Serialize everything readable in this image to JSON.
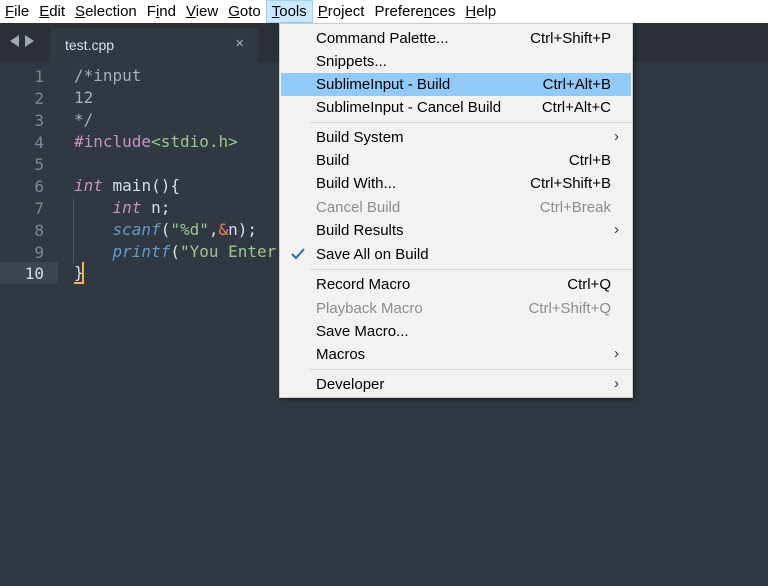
{
  "menubar": {
    "items": [
      {
        "pre": "",
        "u": "F",
        "post": "ile"
      },
      {
        "pre": "",
        "u": "E",
        "post": "dit"
      },
      {
        "pre": "",
        "u": "S",
        "post": "election"
      },
      {
        "pre": "F",
        "u": "i",
        "post": "nd"
      },
      {
        "pre": "",
        "u": "V",
        "post": "iew"
      },
      {
        "pre": "",
        "u": "G",
        "post": "oto"
      },
      {
        "pre": "",
        "u": "T",
        "post": "ools"
      },
      {
        "pre": "",
        "u": "P",
        "post": "roject"
      },
      {
        "pre": "Prefere",
        "u": "n",
        "post": "ces"
      },
      {
        "pre": "",
        "u": "H",
        "post": "elp"
      }
    ]
  },
  "tab": {
    "label": "test.cpp",
    "close": "×"
  },
  "editor": {
    "lines": [
      {
        "num": "1",
        "code": "/*input"
      },
      {
        "num": "2",
        "code": "12"
      },
      {
        "num": "3",
        "code": "*/"
      },
      {
        "num": "4",
        "code": "#include<stdio.h>"
      },
      {
        "num": "5",
        "code": ""
      },
      {
        "num": "6",
        "code": "int main(){"
      },
      {
        "num": "7",
        "code": "    int n;"
      },
      {
        "num": "8",
        "code": "    scanf(\"%d\",&n);"
      },
      {
        "num": "9",
        "code": "    printf(\"You Enter"
      },
      {
        "num": "10",
        "code": "}"
      }
    ],
    "tokens": {
      "l1": "/*input",
      "l2": "12",
      "l3": "*/",
      "l4_pre": "#include",
      "l4_hdr": "<stdio.h>",
      "l6_kw": "int",
      "l6_rest": " main(){",
      "l7_kw": "int",
      "l7_rest": " n;",
      "l8_fn": "scanf",
      "l8_open": "(",
      "l8_str": "\"%d\"",
      "l8_comma": ",",
      "l8_amp": "&",
      "l8_rest": "n);",
      "l9_fn": "printf",
      "l9_open": "(",
      "l9_str": "\"You Enter",
      "l10": "}"
    }
  },
  "dropdown": {
    "items": [
      {
        "label": "Command Palette...",
        "shortcut": "Ctrl+Shift+P"
      },
      {
        "label": "Snippets...",
        "shortcut": ""
      },
      {
        "label": "SublimeInput - Build",
        "shortcut": "Ctrl+Alt+B",
        "highlight": true
      },
      {
        "label": "SublimeInput - Cancel Build",
        "shortcut": "Ctrl+Alt+C"
      },
      {
        "label": "Build System",
        "shortcut": "",
        "submenu": true
      },
      {
        "label": "Build",
        "shortcut": "Ctrl+B"
      },
      {
        "label": "Build With...",
        "shortcut": "Ctrl+Shift+B"
      },
      {
        "label": "Cancel Build",
        "shortcut": "Ctrl+Break",
        "disabled": true
      },
      {
        "label": "Build Results",
        "shortcut": "",
        "submenu": true
      },
      {
        "label": "Save All on Build",
        "shortcut": "",
        "checked": true
      },
      {
        "label": "Record Macro",
        "shortcut": "Ctrl+Q"
      },
      {
        "label": "Playback Macro",
        "shortcut": "Ctrl+Shift+Q",
        "disabled": true
      },
      {
        "label": "Save Macro...",
        "shortcut": ""
      },
      {
        "label": "Macros",
        "shortcut": "",
        "submenu": true
      },
      {
        "label": "Developer",
        "shortcut": "",
        "submenu": true
      }
    ],
    "submenu_glyph": "›"
  },
  "colors": {
    "editor_bg": "#303841",
    "menu_highlight": "#91c9f7",
    "cursor": "#f9ae58",
    "keyword": "#c594c5",
    "function": "#6699cc",
    "string": "#99c794"
  }
}
